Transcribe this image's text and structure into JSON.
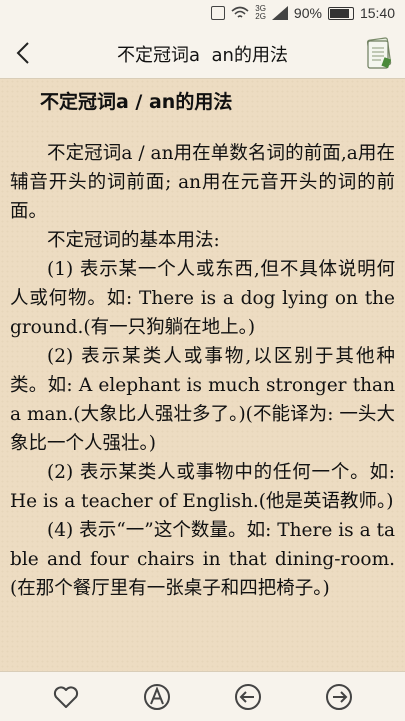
{
  "status_bar": {
    "network_top": "3G",
    "network_bottom": "2G",
    "battery_percent": "90%",
    "battery_level": 0.9,
    "time": "15:40"
  },
  "header": {
    "title": "不定冠词a  an的用法",
    "back_icon": "chevron-left-icon",
    "notes_icon": "notebook-icon"
  },
  "article": {
    "title": "不定冠词a / an的用法",
    "paragraphs": [
      "不定冠词a / an用在单数名词的前面,a用在辅音开头的词前面; an用在元音开头的词的前面。",
      "不定冠词的基本用法:",
      "(1) 表示某一个人或东西,但不具体说明何人或何物。如: There is a dog lying on the ground.(有一只狗躺在地上。)",
      "(2) 表示某类人或事物,以区别于其他种类。如: A elephant is much stronger than a man.(大象比人强壮多了。)(不能译为: 一头大象比一个人强壮。)",
      "(2) 表示某类人或事物中的任何一个。如: He is a teacher of English.(他是英语教师。)",
      "(4) 表示“一”这个数量。如: There is a table and four chairs in that dining-room.(在那个餐厅里有一张桌子和四把椅子。)"
    ]
  },
  "bottom_bar": {
    "items": [
      "heart-icon",
      "font-a-icon",
      "arrow-left-circle-icon",
      "arrow-right-circle-icon"
    ]
  },
  "colors": {
    "paper": "#eddcc2",
    "bar": "#f7f3ec",
    "text": "#111111"
  }
}
